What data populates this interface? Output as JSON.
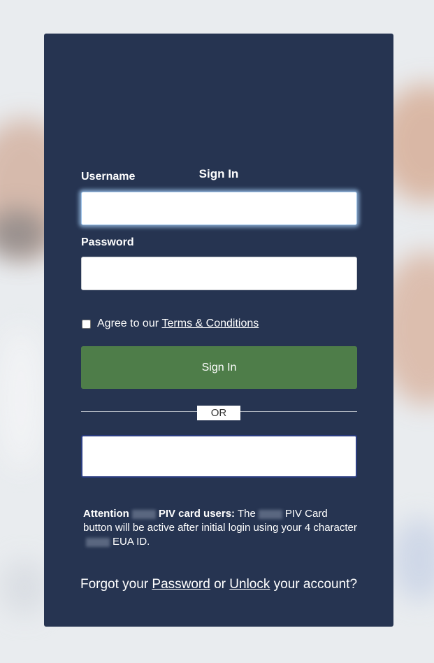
{
  "signin": {
    "title": "Sign In",
    "username_label": "Username",
    "username_value": "",
    "password_label": "Password",
    "password_value": "",
    "agree_prefix": "Agree to our",
    "terms_link": "Terms & Conditions",
    "signin_button": "Sign In",
    "or_label": "OR",
    "piv_button_label": ""
  },
  "attention": {
    "label": "Attention",
    "piv_users": "PIV card users:",
    "text1": "The",
    "text2": "PIV Card button will be active after initial login using your 4 character",
    "text3": "EUA ID."
  },
  "footer": {
    "forgot_prefix": "Forgot your",
    "password_link": "Password",
    "or_text": "or",
    "unlock_link": "Unlock",
    "suffix": "your account?"
  },
  "colors": {
    "card": "#263451",
    "signin_button": "#4e7d49",
    "piv_border": "#2b3d80"
  }
}
